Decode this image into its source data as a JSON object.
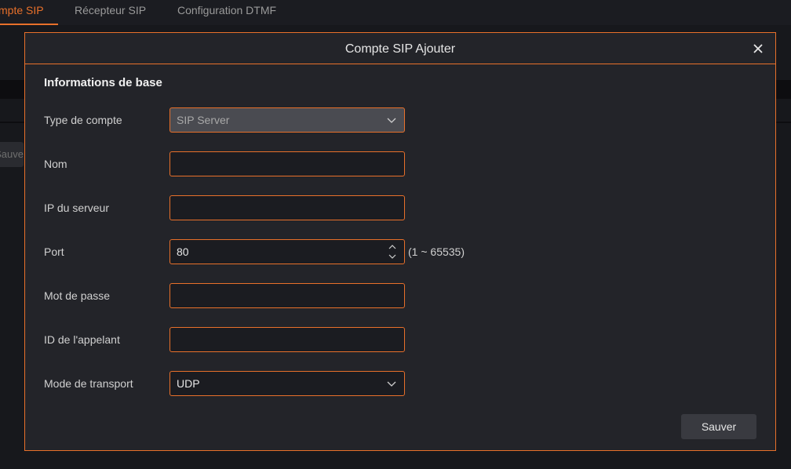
{
  "tabs": [
    {
      "label": "mpte SIP",
      "active": true
    },
    {
      "label": "Récepteur SIP",
      "active": false
    },
    {
      "label": "Configuration DTMF",
      "active": false
    }
  ],
  "background": {
    "save_label": "Sauve"
  },
  "dialog": {
    "title": "Compte SIP Ajouter",
    "section_title": "Informations de base",
    "fields": {
      "account_type": {
        "label": "Type de compte",
        "value": "SIP Server"
      },
      "name": {
        "label": "Nom",
        "value": ""
      },
      "server_ip": {
        "label": "IP du serveur",
        "value": ""
      },
      "port": {
        "label": "Port",
        "value": "80",
        "hint": "(1 ~ 65535)"
      },
      "password": {
        "label": "Mot de passe",
        "value": ""
      },
      "caller_id": {
        "label": "ID de l'appelant",
        "value": ""
      },
      "transport": {
        "label": "Mode de transport",
        "value": "UDP"
      }
    },
    "save_label": "Sauver"
  },
  "colors": {
    "accent": "#e8702a",
    "dialog_bg": "#232429",
    "page_bg": "#17181c"
  }
}
